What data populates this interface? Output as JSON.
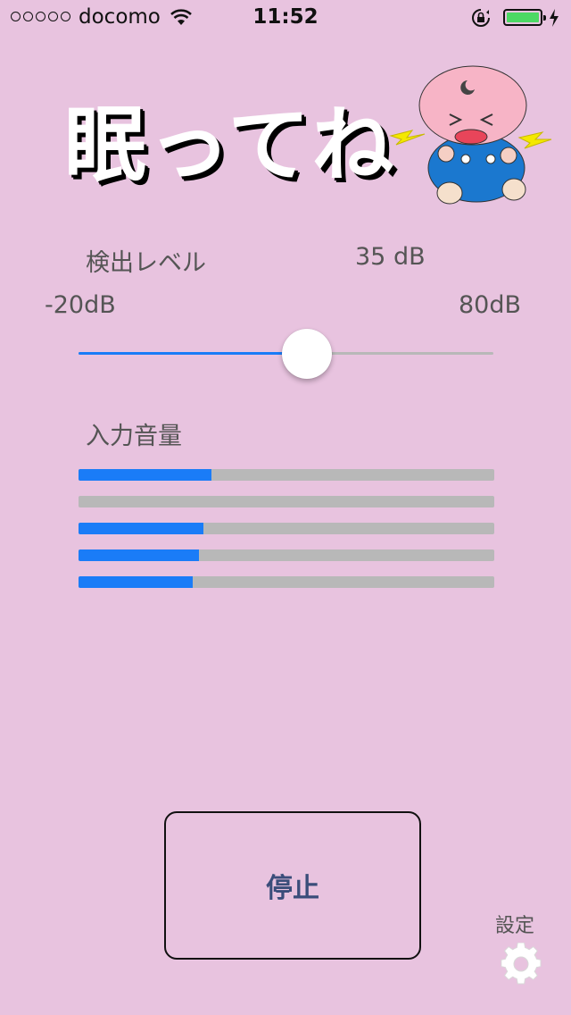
{
  "status": {
    "carrier": "docomo",
    "time": "11:52",
    "battery_color": "#4cd964"
  },
  "header": {
    "title": "眠ってね",
    "mascot_icon": "crying-baby"
  },
  "detection": {
    "label": "検出レベル",
    "value": "35 dB",
    "min_label": "-20dB",
    "max_label": "80dB",
    "slider_fraction": 0.55
  },
  "input": {
    "label": "入力音量",
    "meter_levels": [
      0.32,
      0.0,
      0.3,
      0.29,
      0.275
    ]
  },
  "controls": {
    "stop_label": "停止",
    "settings_label": "設定",
    "settings_icon": "gear-icon"
  },
  "colors": {
    "background": "#e8c3df",
    "accent": "#1a7cf7",
    "track": "#b8b8b8"
  }
}
